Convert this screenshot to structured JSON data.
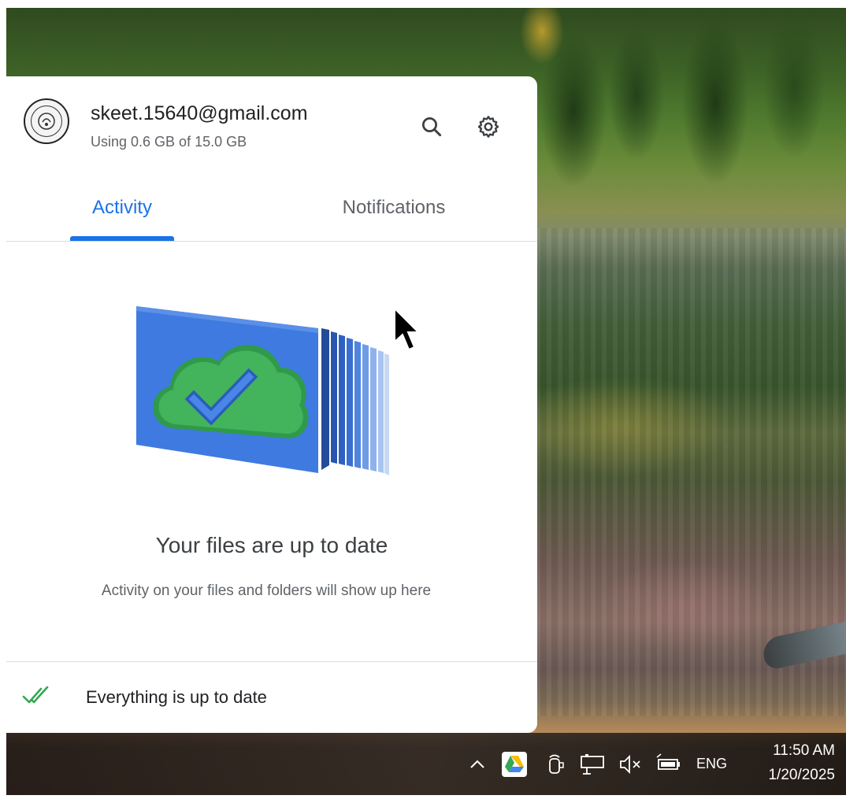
{
  "account": {
    "email": "skeet.15640@gmail.com",
    "storage": "Using 0.6 GB of 15.0 GB"
  },
  "icons": {
    "search": "search-icon",
    "settings": "gear-icon",
    "status": "double-check-icon"
  },
  "tabs": [
    {
      "label": "Activity",
      "selected": true
    },
    {
      "label": "Notifications",
      "selected": false
    }
  ],
  "empty_state": {
    "title": "Your files are up to date",
    "subtitle": "Activity on your files and folders will show up here"
  },
  "footer": {
    "status": "Everything is up to date"
  },
  "taskbar": {
    "language": "ENG",
    "time": "11:50 AM",
    "date": "1/20/2025"
  },
  "colors": {
    "accent": "#1a73e8",
    "cloud_green": "#34a853",
    "folder_blue": "#3f7ae0",
    "check_green": "#34a853"
  }
}
